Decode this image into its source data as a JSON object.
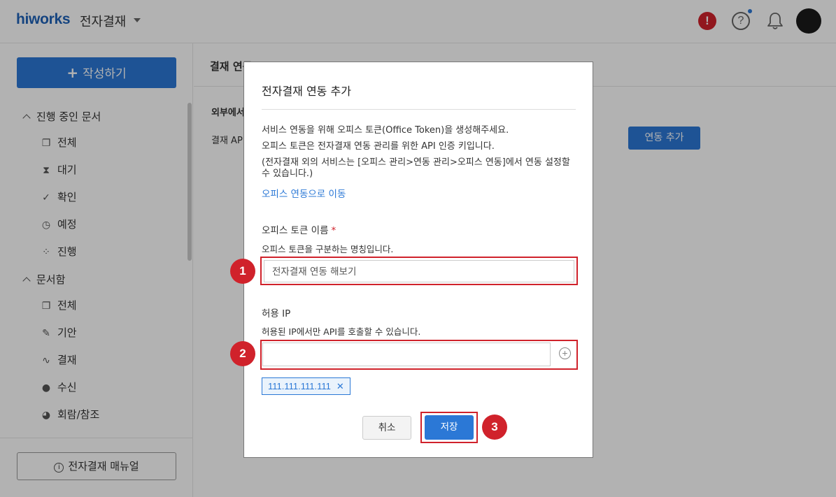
{
  "header": {
    "logo": "hiworks",
    "app_name": "전자결재",
    "alert_glyph": "!",
    "help_glyph": "?"
  },
  "sidebar": {
    "compose_label": "작성하기",
    "groups": [
      {
        "label": "진행 중인 문서",
        "items": [
          {
            "label": "전체",
            "icon": "documents-icon"
          },
          {
            "label": "대기",
            "icon": "hourglass-icon"
          },
          {
            "label": "확인",
            "icon": "check-icon"
          },
          {
            "label": "예정",
            "icon": "clock-icon"
          },
          {
            "label": "진행",
            "icon": "spinner-icon"
          }
        ]
      },
      {
        "label": "문서함",
        "items": [
          {
            "label": "전체",
            "icon": "documents-icon"
          },
          {
            "label": "기안",
            "icon": "pencil-icon"
          },
          {
            "label": "결재",
            "icon": "signature-icon"
          },
          {
            "label": "수신",
            "icon": "person-icon"
          },
          {
            "label": "회람/참조",
            "icon": "person-share-icon"
          }
        ]
      }
    ],
    "manual_label": "전자결재 매뉴얼"
  },
  "main": {
    "title": "결재 연동",
    "section": "외부에서",
    "api_label": "결재 API",
    "add_button": "연동 추가"
  },
  "modal": {
    "title": "전자결재 연동 추가",
    "desc1": "서비스 연동을 위해 오피스 토큰(Office Token)을 생성해주세요.",
    "desc2": "오피스 토큰은 전자결재 연동 관리를 위한 API 인증 키입니다.",
    "desc3": "(전자결재 외의 서비스는 [오피스 관리>연동 관리>오피스 연동]에서 연동 설정할 수 있습니다.)",
    "link": "오피스 연동으로 이동",
    "token_label": "오피스 토큰 이름",
    "token_required": "*",
    "token_help": "오피스 토큰을 구분하는 명칭입니다.",
    "token_value": "전자결재 연동 해보기",
    "ip_label": "허용 IP",
    "ip_help": "허용된 IP에서만 API를 호출할 수 있습니다.",
    "ip_value": "",
    "ip_tag": "111.111.111.111",
    "cancel": "취소",
    "save": "저장"
  },
  "markers": [
    "1",
    "2",
    "3"
  ],
  "colors": {
    "accent": "#2b78d6",
    "highlight": "#d0222b"
  }
}
